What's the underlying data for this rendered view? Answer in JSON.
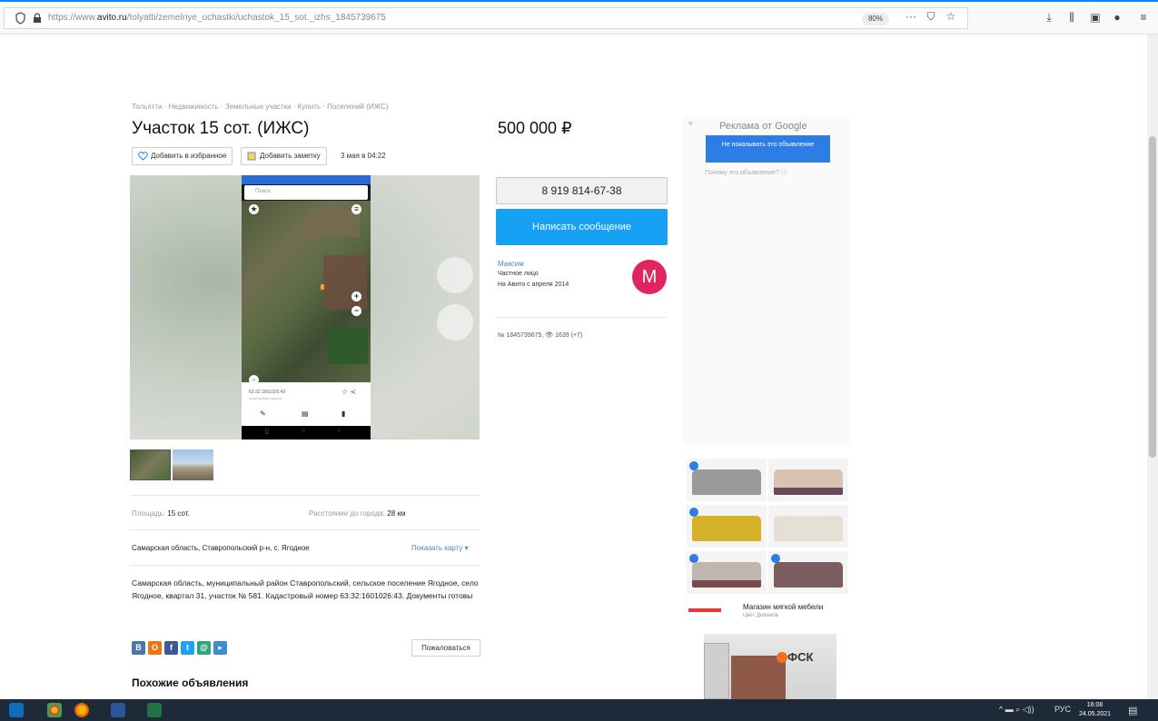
{
  "browser": {
    "url_prefix": "https://www.",
    "url_host": "avito.ru",
    "url_path": "/tolyatti/zemelnye_uchastki/uchastok_15_sot._izhs_1845739675",
    "zoom": "80%",
    "more": "···"
  },
  "listing": {
    "breadcrumb": "Тольятти · Недвижимость · Земельные участки · Купить · Поселений (ИЖС)",
    "title": "Участок 15 сот. (ИЖС)",
    "price": "500 000 ₽",
    "favorite_label": "Добавить в избранное",
    "note_label": "Добавить заметку",
    "date": "3 мая в 04:22"
  },
  "photo": {
    "phone_search": "Поиск",
    "card_number": "63:32:1601026:43",
    "card_subtitle": "Земельный участок"
  },
  "params": {
    "area_label": "Площадь:",
    "area_value": "15 сот.",
    "distance_label": "Расстояние до города:",
    "distance_value": "28 км"
  },
  "address": {
    "short": "Самарская область, Ставропольский р-н, с. Ягодное",
    "show_map": "Показать карту ▾"
  },
  "description": "Самарская область, муниципальный район Ставропольский, сельское поселение Ягодное, село Ягодное, квартал 31, участок № 581. Кадастровый номер 63:32:1601026:43. Документы готовы",
  "share": [
    "В",
    "О",
    "f",
    "t",
    "@",
    "▸"
  ],
  "complain_label": "Пожаловаться",
  "similar_title": "Похожие объявления",
  "contact": {
    "phone": "8 919 814-67-38",
    "message_label": "Написать сообщение",
    "seller_name": "Максим",
    "seller_type": "Частное лицо",
    "seller_since": "На Авито с апреля 2014",
    "avatar_letter": "M",
    "ad_meta": "№ 1845739675, 👁 1639 (+7)"
  },
  "ads": {
    "back": "«",
    "header": "Реклама от Google",
    "hide_label": "Не показывать это объявление",
    "why_label": "Почему это объявление? ⓘ",
    "info": "ⓘ X",
    "sofa_title": "Магазин мягкой мебели",
    "sofa_sub": "Цвет Диванов",
    "banner_brand": "ФСК"
  },
  "taskbar": {
    "tray_icons": "^  ▬  ⌕  ◁))",
    "lang": "РУС",
    "time": "16:08",
    "date": "24.05.2021"
  },
  "colors": {
    "accent": "#16a1f5",
    "link": "#3f8ad1",
    "avatar": "#e0245e"
  }
}
